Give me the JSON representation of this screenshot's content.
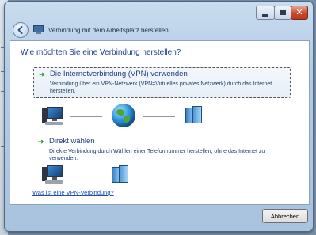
{
  "window": {
    "title": "Verbindung mit dem Arbeitsplatz herstellen",
    "minimize_icon": "minimize-icon",
    "maximize_icon": "maximize-icon",
    "close_icon": "close-icon"
  },
  "content": {
    "question": "Wie möchten Sie eine Verbindung herstellen?",
    "options": [
      {
        "title": "Die Internetverbindung (VPN) verwenden",
        "description": "Verbindung über ein VPN-Netzwerk (VPN=Virtuelles privates Netzwerk) durch das Internet herstellen.",
        "icons": [
          "computer-icon",
          "globe-icon",
          "server-icon"
        ]
      },
      {
        "title": "Direkt wählen",
        "description": "Direkte Verbindung durch Wählen einer Telefonnummer herstellen, ohne das Internet zu verwenden.",
        "icons": [
          "computer-icon",
          "server-icon"
        ]
      }
    ],
    "help_link": "Was ist eine VPN-Verbindung?"
  },
  "footer": {
    "cancel_label": "Abbrechen"
  },
  "colors": {
    "heading": "#1e3d8f",
    "link": "#1a4fb4",
    "arrow": "#0e8f1c"
  }
}
